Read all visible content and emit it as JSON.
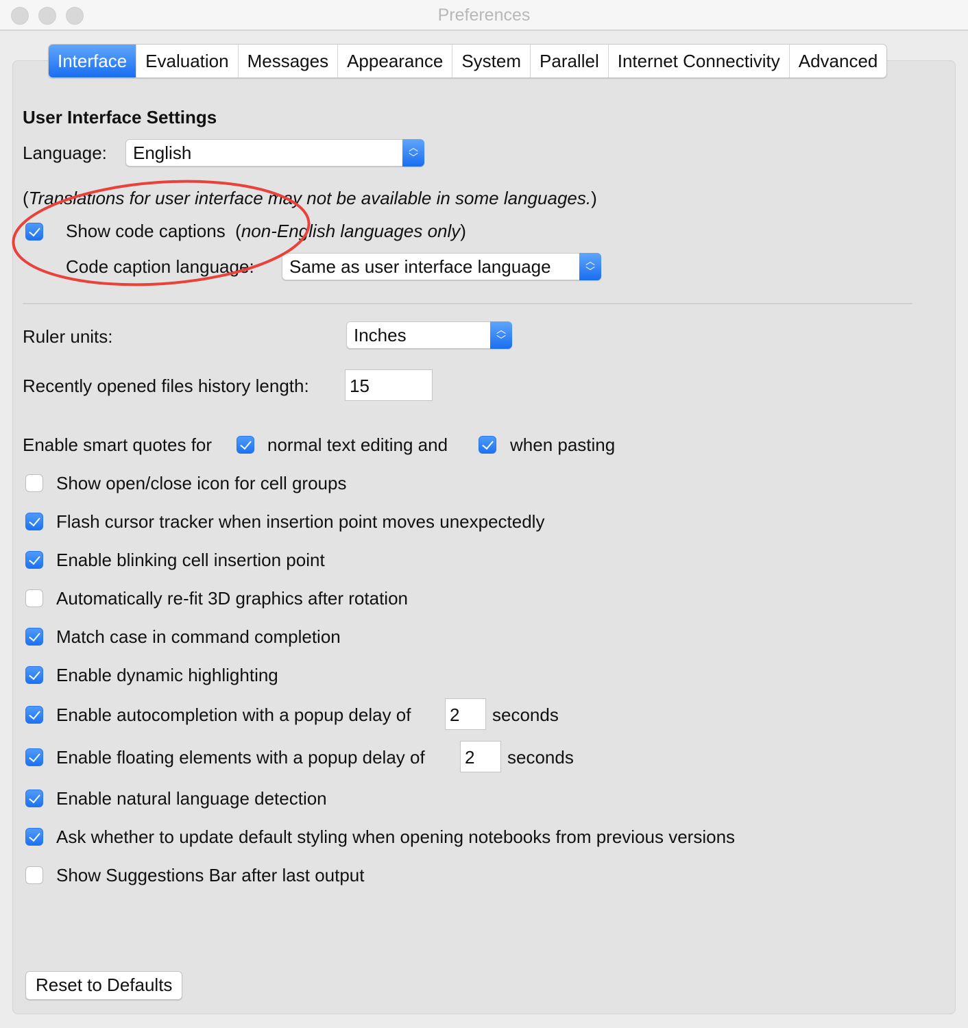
{
  "window": {
    "title": "Preferences"
  },
  "tabs": [
    {
      "label": "Interface",
      "active": true
    },
    {
      "label": "Evaluation"
    },
    {
      "label": "Messages"
    },
    {
      "label": "Appearance"
    },
    {
      "label": "System"
    },
    {
      "label": "Parallel"
    },
    {
      "label": "Internet Connectivity"
    },
    {
      "label": "Advanced"
    }
  ],
  "section": {
    "title": "User Interface Settings"
  },
  "language": {
    "label": "Language:",
    "value": "English"
  },
  "translation_note": {
    "open": "(",
    "text": "Translations for user interface may not be available in some languages.",
    "close": ")"
  },
  "code_captions": {
    "label": "Show code captions",
    "note_open": "(",
    "note": "non-English languages only",
    "note_close": ")",
    "checked": true
  },
  "caption_language": {
    "label": "Code caption language:",
    "value": "Same as user interface language"
  },
  "ruler": {
    "label": "Ruler units:",
    "value": "Inches"
  },
  "history": {
    "label": "Recently opened files history length:",
    "value": "15"
  },
  "smart_quotes": {
    "label": "Enable smart quotes for",
    "opt1": "normal text editing and",
    "opt1_checked": true,
    "opt2": "when pasting",
    "opt2_checked": true
  },
  "options": [
    {
      "label": "Show open/close icon for cell groups",
      "checked": false
    },
    {
      "label": "Flash cursor tracker when insertion point moves unexpectedly",
      "checked": true
    },
    {
      "label": "Enable blinking cell insertion point",
      "checked": true
    },
    {
      "label": "Automatically re-fit 3D graphics after rotation",
      "checked": false
    },
    {
      "label": "Match case in command completion",
      "checked": true
    },
    {
      "label": "Enable dynamic highlighting",
      "checked": true
    }
  ],
  "autocompletion": {
    "label": "Enable autocompletion with a popup delay of",
    "value": "2",
    "unit": "seconds",
    "checked": true
  },
  "floating": {
    "label": "Enable floating elements with a popup delay of",
    "value": "2",
    "unit": "seconds",
    "checked": true
  },
  "options2": [
    {
      "label": "Enable natural language detection",
      "checked": true
    },
    {
      "label": "Ask whether to update default styling when opening notebooks from previous versions",
      "checked": true
    },
    {
      "label": "Show Suggestions Bar after last output",
      "checked": false
    }
  ],
  "reset_label": "Reset to Defaults",
  "colors": {
    "accent": "#1a6ef0",
    "annotation": "#e8423a"
  }
}
